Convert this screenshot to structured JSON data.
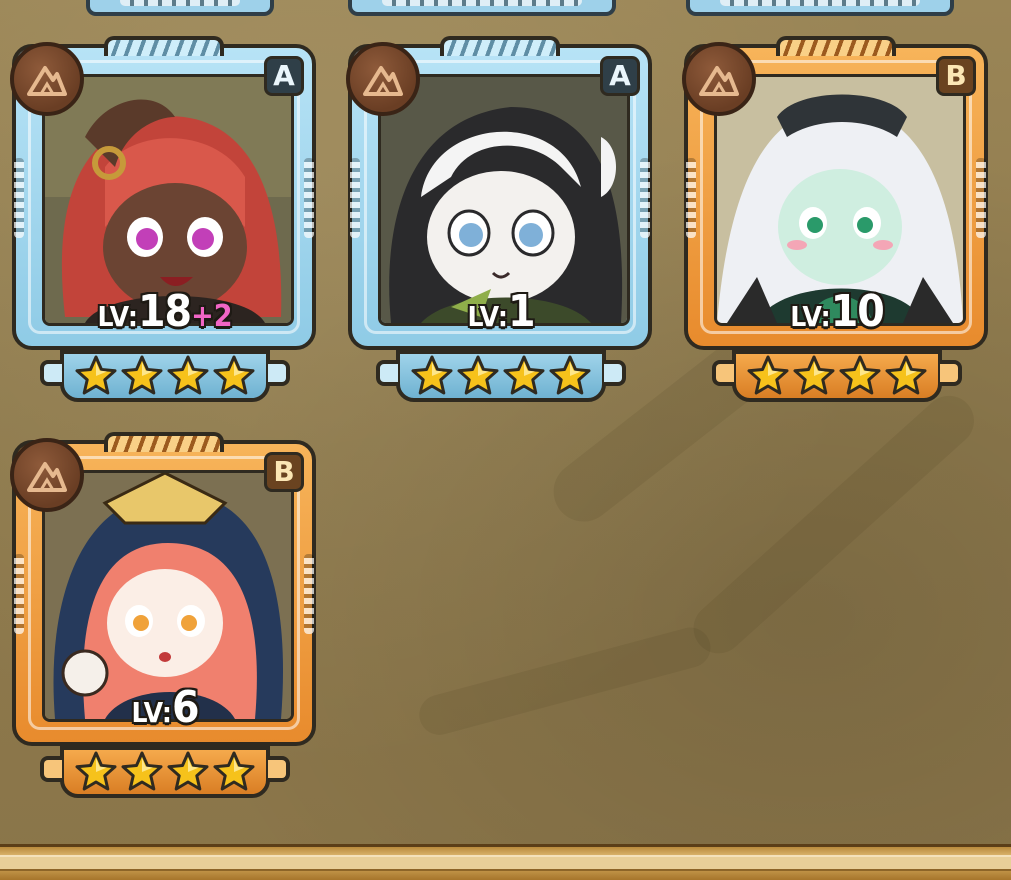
{
  "heroes": [
    {
      "id": "hero-1",
      "rank": "A",
      "frame": "blue",
      "element_icon": "mountain-icon",
      "level_prefix": "LV:",
      "level": "18",
      "level_bonus": "+2",
      "stars": 4,
      "portrait": "red-haired-horned-girl"
    },
    {
      "id": "hero-2",
      "rank": "A",
      "frame": "blue",
      "element_icon": "mountain-icon",
      "level_prefix": "LV:",
      "level": "1",
      "level_bonus": "",
      "stars": 4,
      "portrait": "panda-girl"
    },
    {
      "id": "hero-3",
      "rank": "B",
      "frame": "orange",
      "element_icon": "mountain-icon",
      "level_prefix": "LV:",
      "level": "10",
      "level_bonus": "",
      "stars": 4,
      "portrait": "white-haired-green-dress-girl"
    },
    {
      "id": "hero-4",
      "rank": "B",
      "frame": "orange",
      "element_icon": "mountain-icon",
      "level_prefix": "LV:",
      "level": "6",
      "level_bonus": "",
      "stars": 4,
      "portrait": "hooded-pink-haired-girl"
    }
  ],
  "colors": {
    "background": "#8f7a4e",
    "frame_blue": "#9ed1ea",
    "frame_orange": "#e88b2d",
    "star_fill": "#f6c21b",
    "level_bonus": "#f165c5"
  }
}
